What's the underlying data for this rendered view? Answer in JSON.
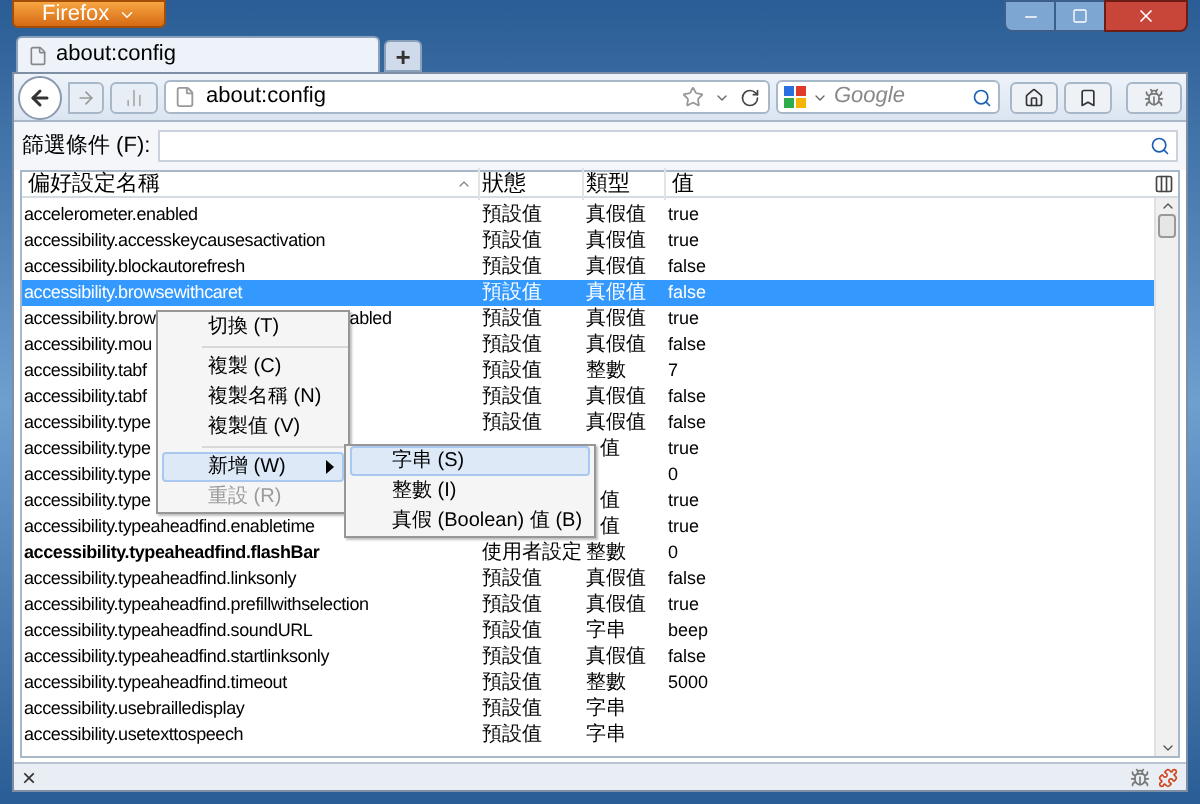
{
  "app_button": "Firefox",
  "tabs": [
    {
      "label": "about:config",
      "selected": true
    }
  ],
  "new_tab": "+",
  "address": {
    "value": "about:config"
  },
  "search": {
    "placeholder": "Google"
  },
  "filter": {
    "label": "篩選條件 (F):"
  },
  "table": {
    "columns": [
      "偏好設定名稱",
      "狀態",
      "類型",
      "值"
    ],
    "rows": [
      {
        "name": "accelerometer.enabled",
        "status": "預設值",
        "type": "真假值",
        "value": "true",
        "selected": false,
        "bold": false
      },
      {
        "name": "accessibility.accesskeycausesactivation",
        "status": "預設值",
        "type": "真假值",
        "value": "true",
        "selected": false,
        "bold": false
      },
      {
        "name": "accessibility.blockautorefresh",
        "status": "預設值",
        "type": "真假值",
        "value": "false",
        "selected": false,
        "bold": false
      },
      {
        "name": "accessibility.browsewithcaret",
        "status": "預設值",
        "type": "真假值",
        "value": "false",
        "selected": true,
        "bold": false
      },
      {
        "name": "accessibility.brow",
        "name_tail": "abled",
        "status": "預設值",
        "type": "真假值",
        "value": "true",
        "selected": false,
        "bold": false
      },
      {
        "name": "accessibility.mou",
        "status": "預設值",
        "type": "真假值",
        "value": "false",
        "selected": false,
        "bold": false
      },
      {
        "name": "accessibility.tabf",
        "status": "預設值",
        "type": "整數",
        "value": "7",
        "selected": false,
        "bold": false
      },
      {
        "name": "accessibility.tabf",
        "status": "預設值",
        "type": "真假值",
        "value": "false",
        "selected": false,
        "bold": false
      },
      {
        "name": "accessibility.type",
        "status": "預設值",
        "type": "真假值",
        "value": "false",
        "selected": false,
        "bold": false
      },
      {
        "name": "accessibility.type",
        "type": "值",
        "type_clipped": true,
        "value": "true",
        "selected": false,
        "bold": false
      },
      {
        "name": "accessibility.type",
        "value": "0",
        "selected": false,
        "bold": false
      },
      {
        "name": "accessibility.type",
        "type": "值",
        "type_clipped": true,
        "value": "true",
        "selected": false,
        "bold": false
      },
      {
        "name": "accessibility.typeaheadfind.enabletime",
        "type": "值",
        "type_clipped": true,
        "value": "true",
        "selected": false,
        "bold": false
      },
      {
        "name": "accessibility.typeaheadfind.flashBar",
        "status": "使用者設定",
        "type": "整數",
        "value": "0",
        "selected": false,
        "bold": true
      },
      {
        "name": "accessibility.typeaheadfind.linksonly",
        "status": "預設值",
        "type": "真假值",
        "value": "false",
        "selected": false,
        "bold": false
      },
      {
        "name": "accessibility.typeaheadfind.prefillwithselection",
        "status": "預設值",
        "type": "真假值",
        "value": "true",
        "selected": false,
        "bold": false
      },
      {
        "name": "accessibility.typeaheadfind.soundURL",
        "status": "預設值",
        "type": "字串",
        "value": "beep",
        "selected": false,
        "bold": false
      },
      {
        "name": "accessibility.typeaheadfind.startlinksonly",
        "status": "預設值",
        "type": "真假值",
        "value": "false",
        "selected": false,
        "bold": false
      },
      {
        "name": "accessibility.typeaheadfind.timeout",
        "status": "預設值",
        "type": "整數",
        "value": "5000",
        "selected": false,
        "bold": false
      },
      {
        "name": "accessibility.usebrailledisplay",
        "status": "預設值",
        "type": "字串",
        "selected": false,
        "bold": false
      },
      {
        "name": "accessibility.usetexttospeech",
        "status": "預設值",
        "type": "字串",
        "selected": false,
        "bold": false
      }
    ]
  },
  "context_menu": [
    {
      "kind": "item",
      "label": "切換 (T)",
      "selected": false,
      "disabled": false
    },
    {
      "kind": "separator"
    },
    {
      "kind": "item",
      "label": "複製 (C)",
      "selected": false,
      "disabled": false
    },
    {
      "kind": "item",
      "label": "複製名稱 (N)",
      "selected": false,
      "disabled": false
    },
    {
      "kind": "item",
      "label": "複製值 (V)",
      "selected": false,
      "disabled": false
    },
    {
      "kind": "separator"
    },
    {
      "kind": "submenu",
      "label": "新增 (W)",
      "selected": true,
      "disabled": false
    },
    {
      "kind": "item",
      "label": "重設 (R)",
      "selected": false,
      "disabled": true
    }
  ],
  "submenu": [
    {
      "label": "字串 (S)",
      "selected": true
    },
    {
      "label": "整數 (I)",
      "selected": false
    },
    {
      "label": "真假 (Boolean) 值 (B)",
      "selected": false
    }
  ],
  "status_bar": {
    "close": "×"
  }
}
